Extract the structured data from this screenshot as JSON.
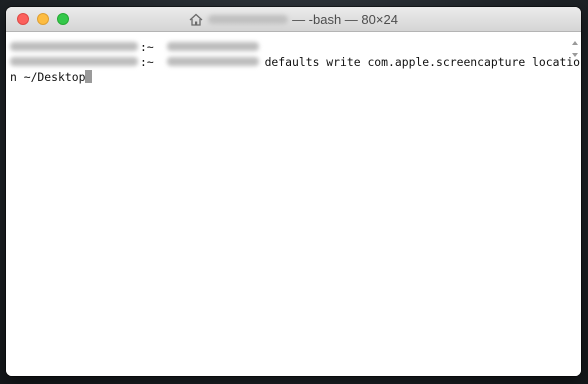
{
  "window": {
    "title_text": "— -bash — 80×24"
  },
  "terminal": {
    "line1_suffix": ":~ ",
    "line2_suffix": ":~ ",
    "command_part1": "defaults write com.apple.screencapture locatio",
    "command_part2": "n ~/Desktop"
  },
  "icons": {
    "title": "home-icon",
    "scroll_up": "scroll-up-arrow-icon",
    "scroll_down": "scroll-down-arrow-icon"
  },
  "colors": {
    "close": "#fc605c",
    "minimize": "#fdbc40",
    "zoom": "#34c84a",
    "terminal_background": "#ffffff",
    "cursor": "#9a9a9a"
  }
}
